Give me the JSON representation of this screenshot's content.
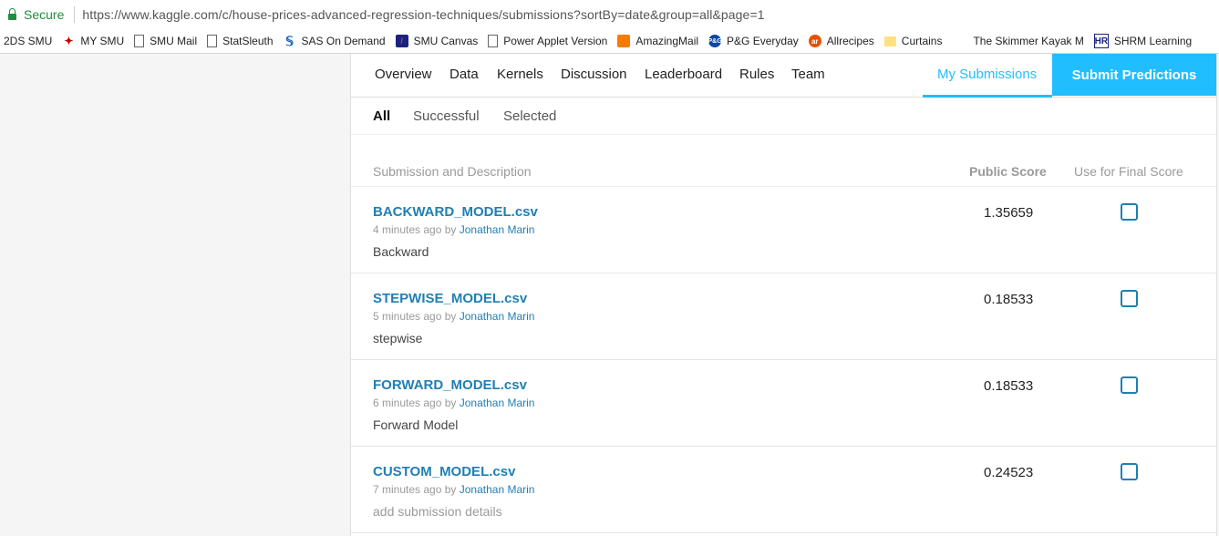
{
  "browser": {
    "secure_label": "Secure",
    "url": "https://www.kaggle.com/c/house-prices-advanced-regression-techniques/submissions?sortBy=date&group=all&page=1"
  },
  "bookmarks": [
    {
      "label": "2DS SMU",
      "icon": "none"
    },
    {
      "label": "MY SMU",
      "icon": "smu-logo-icon"
    },
    {
      "label": "SMU Mail",
      "icon": "document-icon"
    },
    {
      "label": "StatSleuth",
      "icon": "document-icon"
    },
    {
      "label": "SAS On Demand",
      "icon": "sas-logo-icon"
    },
    {
      "label": "SMU Canvas",
      "icon": "canvas-logo-icon"
    },
    {
      "label": "Power Applet Version",
      "icon": "document-icon"
    },
    {
      "label": "AmazingMail",
      "icon": "amazingmail-logo-icon"
    },
    {
      "label": "P&G Everyday",
      "icon": "pg-logo-icon"
    },
    {
      "label": "Allrecipes",
      "icon": "allrecipes-logo-icon"
    },
    {
      "label": "Curtains",
      "icon": "folder-icon"
    },
    {
      "label": "The Skimmer Kayak M",
      "icon": "none"
    },
    {
      "label": "SHRM Learning",
      "icon": "shrm-logo-icon"
    }
  ],
  "nav": {
    "tabs": [
      "Overview",
      "Data",
      "Kernels",
      "Discussion",
      "Leaderboard",
      "Rules",
      "Team"
    ],
    "my_submissions": "My Submissions",
    "submit_predictions": "Submit Predictions"
  },
  "filters": {
    "all": "All",
    "successful": "Successful",
    "selected": "Selected"
  },
  "table": {
    "headers": {
      "submission": "Submission and Description",
      "public_score": "Public Score",
      "final_score": "Use for Final Score"
    },
    "rows": [
      {
        "file": "BACKWARD_MODEL.csv",
        "time": "4 minutes ago by",
        "author": "Jonathan Marin",
        "description": "Backward",
        "score": "1.35659"
      },
      {
        "file": "STEPWISE_MODEL.csv",
        "time": "5 minutes ago by",
        "author": "Jonathan Marin",
        "description": "stepwise",
        "score": "0.18533"
      },
      {
        "file": "FORWARD_MODEL.csv",
        "time": "6 minutes ago by",
        "author": "Jonathan Marin",
        "description": "Forward Model",
        "score": "0.18533"
      },
      {
        "file": "CUSTOM_MODEL.csv",
        "time": "7 minutes ago by",
        "author": "Jonathan Marin",
        "description": "add submission details",
        "score": "0.24523"
      }
    ]
  },
  "colors": {
    "accent": "#20beff",
    "link": "#1f7fb5"
  }
}
